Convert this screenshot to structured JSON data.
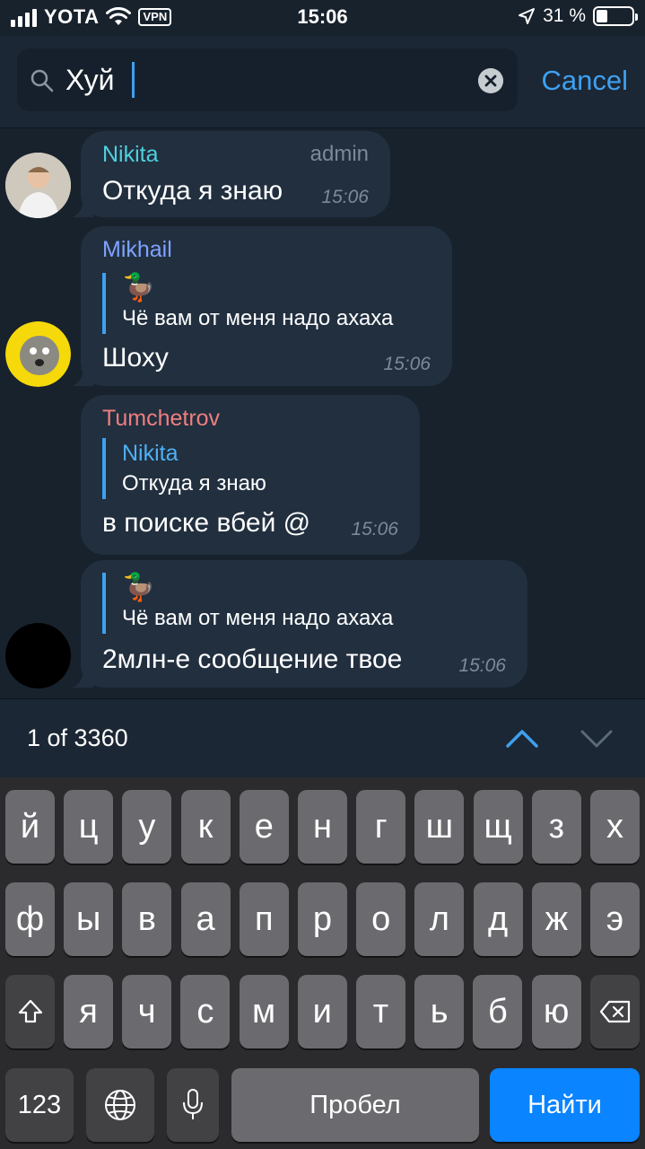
{
  "status_bar": {
    "carrier": "YOTA",
    "vpn": "VPN",
    "time": "15:06",
    "battery_percent": "31 %",
    "battery_level": 0.31
  },
  "search": {
    "query": "Хуй",
    "cancel_label": "Cancel",
    "icons": [
      "search-icon",
      "clear-icon"
    ]
  },
  "messages": [
    {
      "sender": "Nikita",
      "sender_color": "#4fd0de",
      "badge": "admin",
      "text": "Откуда я знаю",
      "time": "15:06"
    },
    {
      "sender": "Mikhail",
      "sender_color": "#7fa2ff",
      "reply": {
        "icon": "duck",
        "emoji": "🦆",
        "text": "Чё вам от меня надо ахаха"
      },
      "text": "Шоху",
      "time": "15:06"
    },
    {
      "sender": "Tumchetrov",
      "sender_color": "#ee7f7f",
      "reply": {
        "name": "Nikita",
        "text": "Откуда я знаю"
      },
      "text": "в поиске вбей @",
      "time": "15:06"
    },
    {
      "reply": {
        "icon": "duck",
        "emoji": "🦆",
        "text": "Чё вам от меня надо ахаха"
      },
      "text": "2млн-е сообщение твое",
      "time": "15:06"
    }
  ],
  "results": {
    "count_label": "1 of 3360",
    "icons": [
      "chevron-up-icon",
      "chevron-down-icon"
    ]
  },
  "keyboard": {
    "row1": [
      "й",
      "ц",
      "у",
      "к",
      "е",
      "н",
      "г",
      "ш",
      "щ",
      "з",
      "х"
    ],
    "row2": [
      "ф",
      "ы",
      "в",
      "а",
      "п",
      "р",
      "о",
      "л",
      "д",
      "ж",
      "э"
    ],
    "row3": [
      "я",
      "ч",
      "с",
      "м",
      "и",
      "т",
      "ь",
      "б",
      "ю"
    ],
    "numbers_label": "123",
    "space_label": "Пробел",
    "action_label": "Найти",
    "icons": [
      "shift-icon",
      "backspace-icon",
      "globe-icon",
      "microphone-icon"
    ]
  },
  "colors": {
    "accent": "#3ea0f0",
    "bubble": "#212f3f",
    "background": "#18222d",
    "action_key": "#0a84ff"
  }
}
